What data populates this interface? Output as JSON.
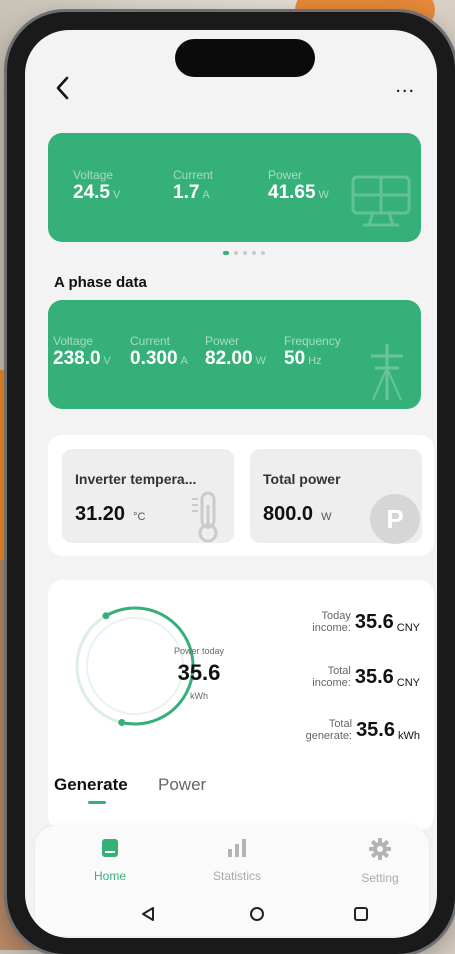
{
  "topbar": {
    "more_label": "..."
  },
  "pv_card": {
    "metrics": [
      {
        "label": "Voltage",
        "value": "24.5",
        "unit": "V"
      },
      {
        "label": "Current",
        "value": "1.7",
        "unit": "A"
      },
      {
        "label": "Power",
        "value": "41.65",
        "unit": "W"
      }
    ]
  },
  "pager": {
    "count": 5,
    "active": 0
  },
  "phase": {
    "title": "A phase data",
    "metrics": [
      {
        "label": "Voltage",
        "value": "238.0",
        "unit": "V"
      },
      {
        "label": "Current",
        "value": "0.300",
        "unit": "A"
      },
      {
        "label": "Power",
        "value": "82.00",
        "unit": "W"
      },
      {
        "label": "Frequency",
        "value": "50",
        "unit": "Hz"
      }
    ]
  },
  "tiles": {
    "temperature": {
      "label": "Inverter tempera...",
      "value": "31.20",
      "unit": "°C"
    },
    "total_power": {
      "label": "Total power",
      "value": "800.0",
      "unit": "W",
      "badge": "P"
    }
  },
  "power_today": {
    "label": "Power today",
    "value": "35.6",
    "unit": "kWh",
    "progress": 0.62
  },
  "income": [
    {
      "label_line1": "Today",
      "label_line2": "income:",
      "value": "35.6",
      "unit": "CNY"
    },
    {
      "label_line1": "Total",
      "label_line2": "income:",
      "value": "35.6",
      "unit": "CNY"
    },
    {
      "label_line1": "Total",
      "label_line2": "generate:",
      "value": "35.6",
      "unit": "kWh"
    }
  ],
  "tabs": {
    "generate": "Generate",
    "power": "Power",
    "active": "generate"
  },
  "nav": {
    "home": "Home",
    "statistics": "Statistics",
    "setting": "Setting"
  },
  "colors": {
    "accent": "#36b079",
    "background": "#f3f3f3",
    "panel": "#ffffff"
  }
}
